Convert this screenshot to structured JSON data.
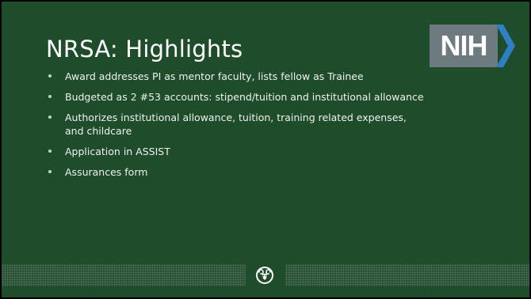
{
  "slide": {
    "title": "NRSA: Highlights",
    "logo_text": "NIH",
    "bullets": [
      "Award addresses PI as mentor faculty, lists fellow as Trainee",
      "Budgeted as 2 #53 accounts: stipend/tuition and institutional allowance",
      "Authorizes institutional allowance, tuition, training related expenses, and childcare",
      "Application in ASSIST",
      "Assurances form"
    ]
  },
  "colors": {
    "background": "#1f4d2c",
    "frame": "#000000",
    "logo_box": "#6d7a80",
    "logo_chevron": "#2f7fc4",
    "text": "#eef2ee"
  },
  "icons": {
    "brand": "nih-logo",
    "footer": "ram-head-icon"
  }
}
